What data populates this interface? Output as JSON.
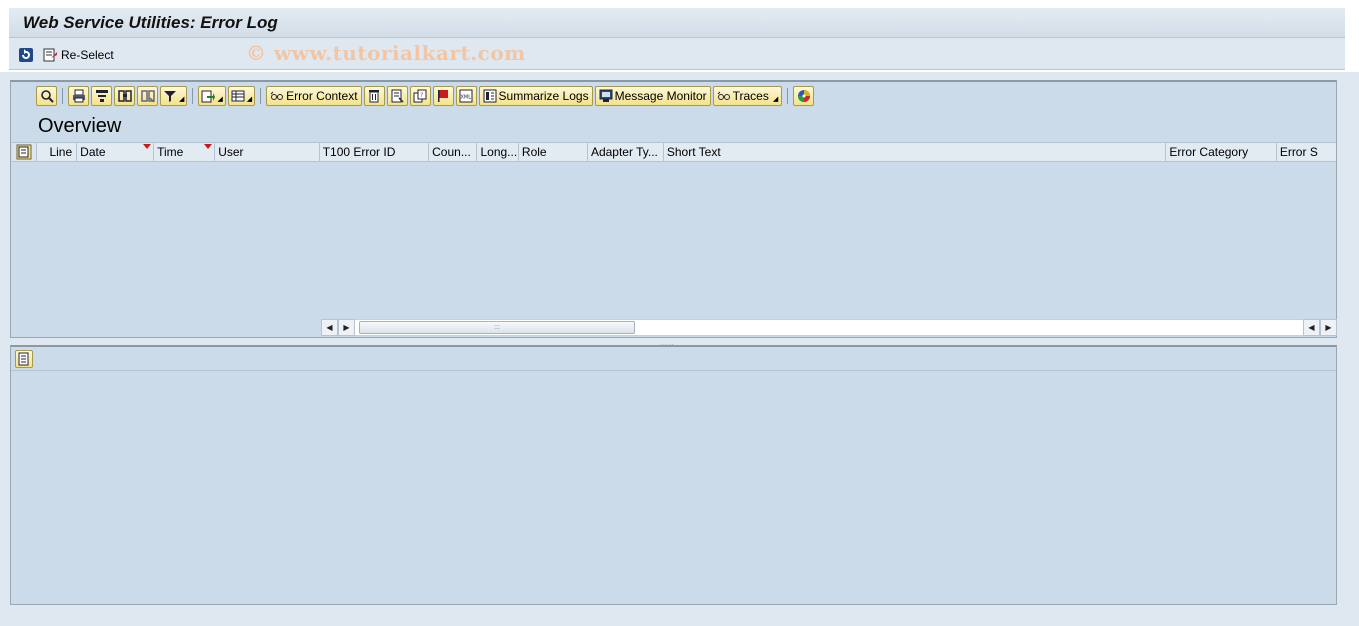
{
  "window": {
    "title": "Web Service Utilities: Error Log"
  },
  "appbar": {
    "reselect_label": "Re-Select"
  },
  "watermark": "© www.tutorialkart.com",
  "toolbar": {
    "buttons": [
      {
        "name": "details-icon"
      },
      {
        "name": "print-icon"
      },
      {
        "name": "sort-icon"
      },
      {
        "name": "find-icon"
      },
      {
        "name": "find-next-icon"
      },
      {
        "name": "filter-icon",
        "dropdown": true
      },
      {
        "name": "export-icon",
        "dropdown": true
      },
      {
        "name": "layout-icon",
        "dropdown": true
      }
    ],
    "error_context": "Error Context",
    "summarize_logs": "Summarize Logs",
    "message_monitor": "Message Monitor",
    "traces": "Traces"
  },
  "overview": {
    "title": "Overview",
    "columns": [
      {
        "label": "Line"
      },
      {
        "label": "Date",
        "sorted": true
      },
      {
        "label": "Time",
        "sorted": true
      },
      {
        "label": "User"
      },
      {
        "label": "T100 Error ID"
      },
      {
        "label": "Coun..."
      },
      {
        "label": "Long..."
      },
      {
        "label": "Role"
      },
      {
        "label": "Adapter Ty..."
      },
      {
        "label": "Short Text"
      },
      {
        "label": "Error Category"
      },
      {
        "label": "Error S"
      }
    ],
    "rows": []
  },
  "colors": {
    "panel_bg": "#cbdbea",
    "button_bg": "#f3e38a",
    "sort_marker": "#cc1a1a"
  }
}
